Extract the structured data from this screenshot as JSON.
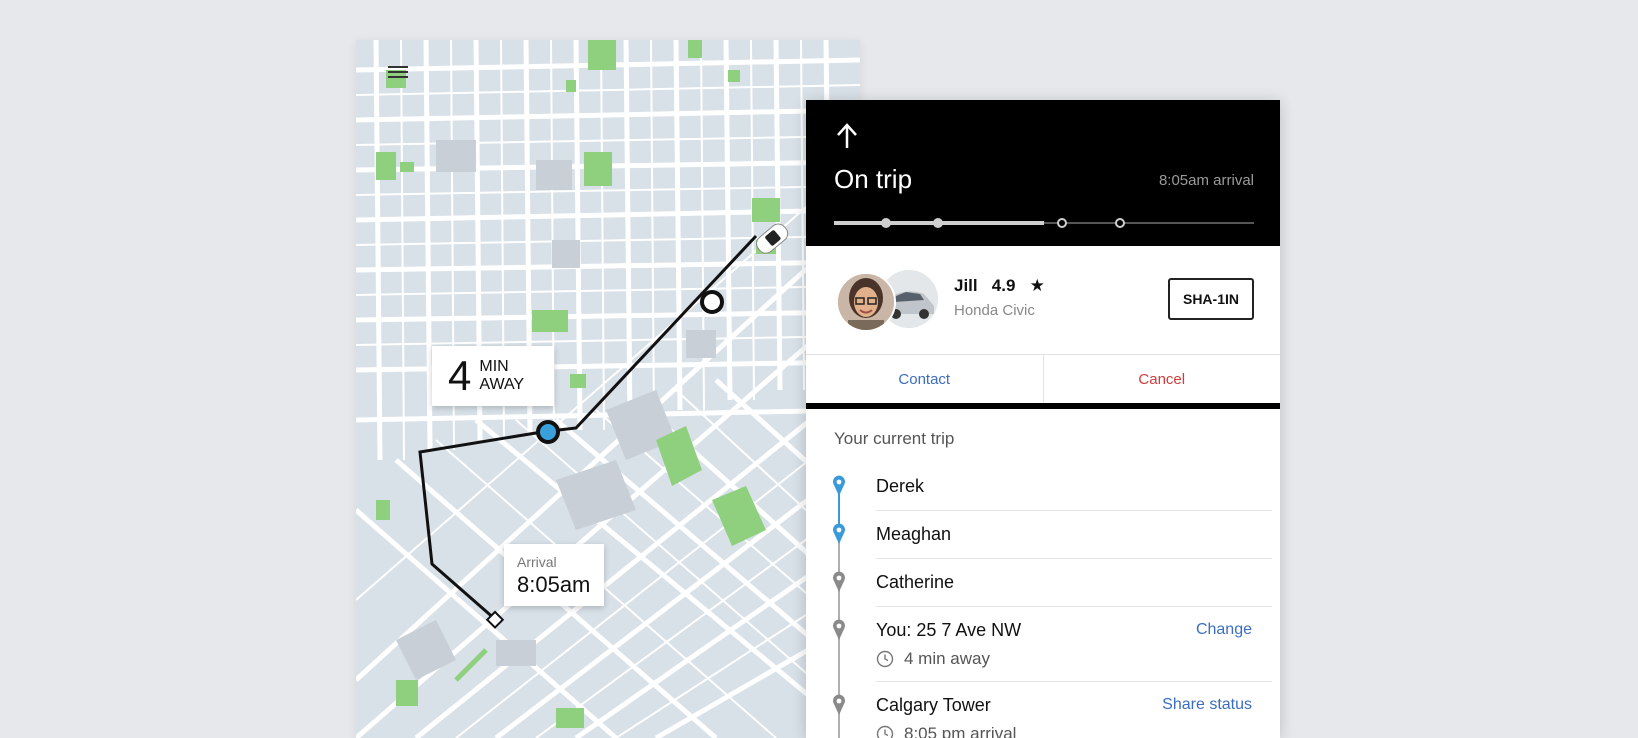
{
  "header": {
    "status": "On trip",
    "arrival": "8:05am arrival",
    "progress_done_stops": 2,
    "progress_total_stops": 4
  },
  "map": {
    "eta_number": "4",
    "eta_unit_line1": "MIN",
    "eta_unit_line2": "AWAY",
    "arrival_label": "Arrival",
    "arrival_time": "8:05am"
  },
  "driver": {
    "name": "Jill",
    "rating": "4.9",
    "star": "★",
    "car": "Honda Civic",
    "plate": "SHA-1IN"
  },
  "actions": {
    "contact": "Contact",
    "cancel": "Cancel"
  },
  "trip": {
    "title": "Your current trip",
    "stops": [
      {
        "name": "Derek"
      },
      {
        "name": "Meaghan"
      },
      {
        "name": "Catherine"
      },
      {
        "name": "You: 25 7 Ave NW",
        "sub": "4 min away",
        "link": "Change"
      },
      {
        "name": "Calgary Tower",
        "sub": "8:05 pm arrival",
        "link": "Share status"
      }
    ]
  },
  "colors": {
    "accent_blue": "#3b6ec2",
    "cancel_red": "#d13c3c",
    "completed_pin": "#3a9ad9",
    "pending_pin": "#8a8a8a",
    "park_green": "#8fd07f"
  }
}
